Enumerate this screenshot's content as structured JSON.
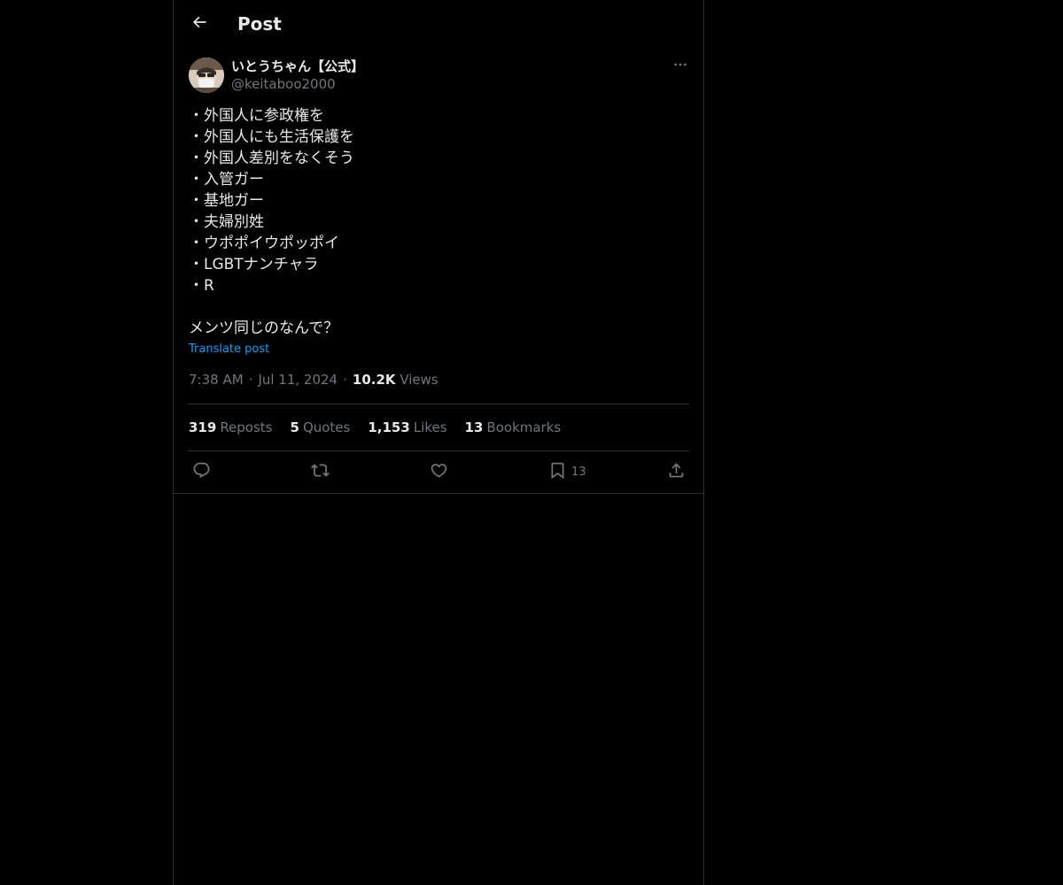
{
  "header": {
    "title": "Post"
  },
  "author": {
    "display_name": "いとうちゃん【公式】",
    "handle": "@keitaboo2000"
  },
  "post": {
    "lines": [
      "・外国人に参政権を",
      "・外国人にも生活保護を",
      "・外国人差別をなくそう",
      "・入管ガー",
      "・基地ガー",
      "・夫婦別姓",
      "・ウポポイウポッポイ",
      "・LGBTナンチャラ",
      "・R",
      "",
      "メンツ同じのなんで？"
    ],
    "translate_label": "Translate post",
    "time": "7:38 AM",
    "date": "Jul 11, 2024",
    "separator": "·",
    "views_count": "10.2K",
    "views_label": "Views"
  },
  "stats": {
    "reposts_count": "319",
    "reposts_label": "Reposts",
    "quotes_count": "5",
    "quotes_label": "Quotes",
    "likes_count": "1,153",
    "likes_label": "Likes",
    "bookmarks_count": "13",
    "bookmarks_label": "Bookmarks"
  },
  "actions": {
    "bookmark_count": "13"
  },
  "icons": {
    "back": "arrow-left-icon",
    "more": "more-horizontal-icon",
    "reply": "reply-icon",
    "repost": "repost-icon",
    "like": "heart-icon",
    "bookmark": "bookmark-icon",
    "share": "share-icon"
  },
  "colors": {
    "background": "#000000",
    "text": "#e7e9ea",
    "muted": "#71767b",
    "border": "#2f3336",
    "link": "#1d9bf0"
  }
}
